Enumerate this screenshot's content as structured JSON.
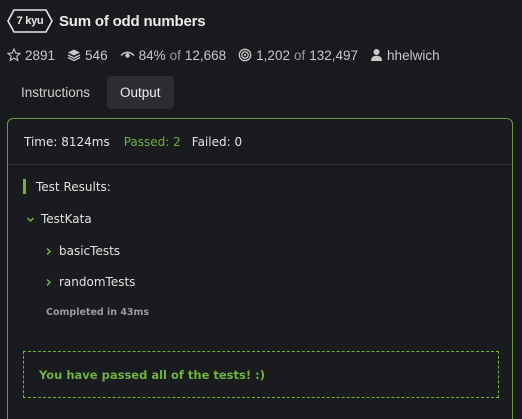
{
  "kata": {
    "kyu": "7 kyu",
    "title": "Sum of odd numbers"
  },
  "stats": {
    "stars": "2891",
    "collections": "546",
    "satisfaction": "84%",
    "satisfaction_of_word": "of",
    "votes": "12,668",
    "completions": "1,202",
    "completions_of_word": "of",
    "attempts": "132,497",
    "author": "hhelwich"
  },
  "tabs": [
    {
      "label": "Instructions",
      "active": false
    },
    {
      "label": "Output",
      "active": true
    }
  ],
  "output": {
    "time": "Time: 8124ms",
    "passed": "Passed: 2",
    "failed": "Failed: 0",
    "results_header": "Test Results:",
    "suite": "TestKata",
    "tests": [
      "basicTests",
      "randomTests"
    ],
    "completed": "Completed in 43ms",
    "success_message": "You have passed all of the tests! :)"
  },
  "colors": {
    "accent_green": "#6fb33c",
    "panel_border": "#6e9a3c",
    "background": "#191a1d"
  },
  "icons": {
    "kyu": "hexagon-badge",
    "stars": "star-outline-icon",
    "collections": "layers-icon",
    "satisfaction": "eye-icon",
    "completions": "target-icon",
    "author": "user-icon",
    "suite_toggle": "chevron-down-icon",
    "test_toggle": "chevron-right-icon"
  }
}
